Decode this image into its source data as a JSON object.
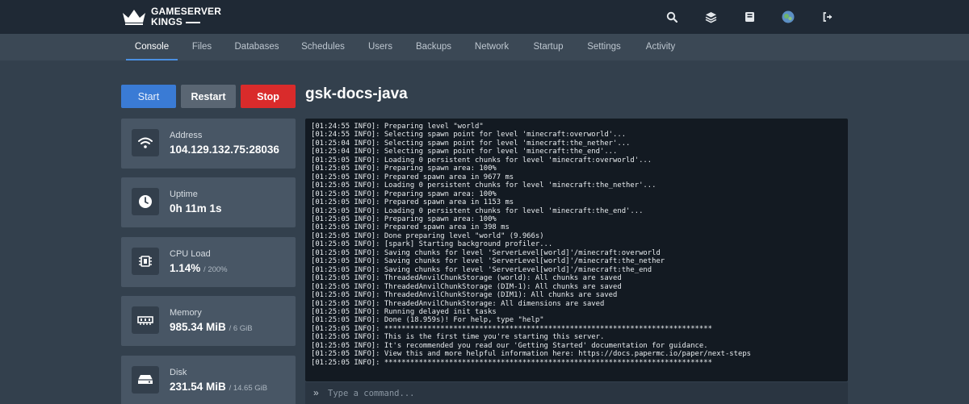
{
  "brand": {
    "line1": "GAMESERVER",
    "line2": "KINGS"
  },
  "topbar": {
    "icons": [
      "search-icon",
      "layers-icon",
      "book-icon",
      "avatar",
      "logout-icon"
    ]
  },
  "tabs": [
    {
      "label": "Console",
      "active": true
    },
    {
      "label": "Files"
    },
    {
      "label": "Databases"
    },
    {
      "label": "Schedules"
    },
    {
      "label": "Users"
    },
    {
      "label": "Backups"
    },
    {
      "label": "Network"
    },
    {
      "label": "Startup"
    },
    {
      "label": "Settings"
    },
    {
      "label": "Activity"
    }
  ],
  "controls": {
    "start": "Start",
    "restart": "Restart",
    "stop": "Stop"
  },
  "server": {
    "name": "gsk-docs-java"
  },
  "stats": {
    "address": {
      "label": "Address",
      "value": "104.129.132.75:28036",
      "icon": "wifi-icon"
    },
    "uptime": {
      "label": "Uptime",
      "value": "0h 11m 1s",
      "icon": "clock-icon"
    },
    "cpu": {
      "label": "CPU Load",
      "value": "1.14%",
      "limit": "/ 200%",
      "icon": "cpu-icon"
    },
    "memory": {
      "label": "Memory",
      "value": "985.34 MiB",
      "limit": "/ 6 GiB",
      "icon": "memory-icon"
    },
    "disk": {
      "label": "Disk",
      "value": "231.54 MiB",
      "limit": "/ 14.65 GiB",
      "icon": "disk-icon"
    }
  },
  "console": {
    "lines": [
      "[01:24:55 INFO]: Preparing level \"world\"",
      "[01:24:55 INFO]: Selecting spawn point for level 'minecraft:overworld'...",
      "[01:25:04 INFO]: Selecting spawn point for level 'minecraft:the_nether'...",
      "[01:25:04 INFO]: Selecting spawn point for level 'minecraft:the_end'...",
      "[01:25:05 INFO]: Loading 0 persistent chunks for level 'minecraft:overworld'...",
      "[01:25:05 INFO]: Preparing spawn area: 100%",
      "[01:25:05 INFO]: Prepared spawn area in 9677 ms",
      "[01:25:05 INFO]: Loading 0 persistent chunks for level 'minecraft:the_nether'...",
      "[01:25:05 INFO]: Preparing spawn area: 100%",
      "[01:25:05 INFO]: Prepared spawn area in 1153 ms",
      "[01:25:05 INFO]: Loading 0 persistent chunks for level 'minecraft:the_end'...",
      "[01:25:05 INFO]: Preparing spawn area: 100%",
      "[01:25:05 INFO]: Prepared spawn area in 398 ms",
      "[01:25:05 INFO]: Done preparing level \"world\" (9.966s)",
      "[01:25:05 INFO]: [spark] Starting background profiler...",
      "[01:25:05 INFO]: Saving chunks for level 'ServerLevel[world]'/minecraft:overworld",
      "[01:25:05 INFO]: Saving chunks for level 'ServerLevel[world]'/minecraft:the_nether",
      "[01:25:05 INFO]: Saving chunks for level 'ServerLevel[world]'/minecraft:the_end",
      "[01:25:05 INFO]: ThreadedAnvilChunkStorage (world): All chunks are saved",
      "[01:25:05 INFO]: ThreadedAnvilChunkStorage (DIM-1): All chunks are saved",
      "[01:25:05 INFO]: ThreadedAnvilChunkStorage (DIM1): All chunks are saved",
      "[01:25:05 INFO]: ThreadedAnvilChunkStorage: All dimensions are saved",
      "[01:25:05 INFO]: Running delayed init tasks",
      "[01:25:05 INFO]: Done (18.959s)! For help, type \"help\"",
      "[01:25:05 INFO]: ****************************************************************************",
      "[01:25:05 INFO]: This is the first time you're starting this server.",
      "[01:25:05 INFO]: It's recommended you read our 'Getting Started' documentation for guidance.",
      "[01:25:05 INFO]: View this and more helpful information here: https://docs.papermc.io/paper/next-steps",
      "[01:25:05 INFO]: ****************************************************************************"
    ]
  },
  "command": {
    "placeholder": "Type a command..."
  },
  "colors": {
    "topbar": "#1f2935",
    "accent": "#4a90e2",
    "start": "#3a7bd5",
    "restart": "#5a6673",
    "stop": "#d92b2b",
    "console_bg": "#131a22"
  }
}
